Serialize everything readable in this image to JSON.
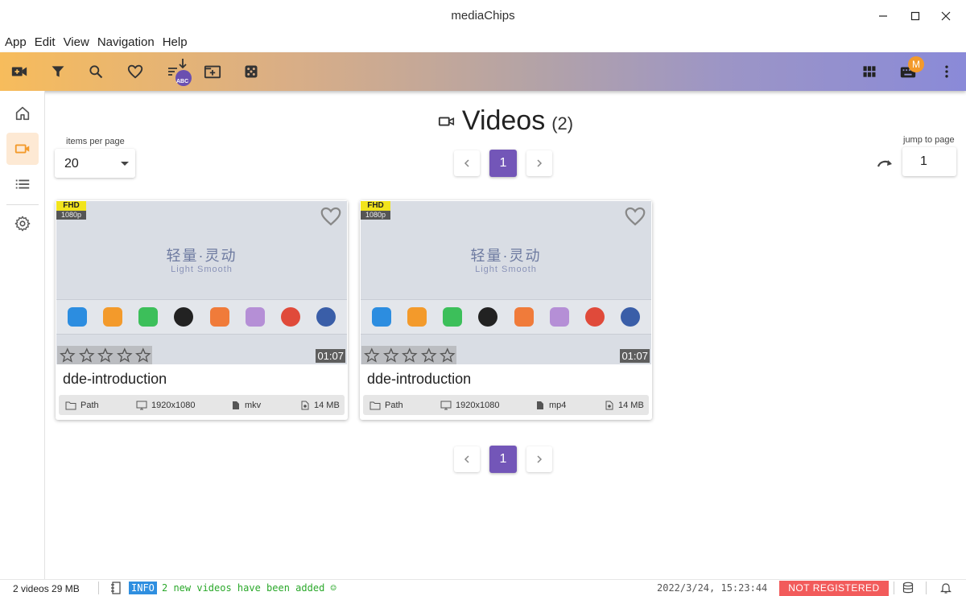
{
  "window": {
    "title": "mediaChips"
  },
  "menu": [
    "App",
    "Edit",
    "View",
    "Navigation",
    "Help"
  ],
  "toolbar": {
    "sort_badge": "ABC",
    "avatar_letter": "M",
    "icons": [
      "add-video-icon",
      "filter-icon",
      "search-icon",
      "heart-icon",
      "sort-icon",
      "add-tab-icon",
      "dice-icon",
      "grid-view-icon",
      "keyboard-icon",
      "more-vert-icon"
    ]
  },
  "sidebar": {
    "items": [
      "home-icon",
      "videos-icon",
      "list-icon",
      "settings-icon"
    ],
    "active": "videos-icon"
  },
  "page": {
    "title": "Videos",
    "count": "(2)",
    "items_per_page_label": "items per page",
    "items_per_page": "20",
    "current_page": "1",
    "jump_label": "jump to page",
    "jump_value": "1"
  },
  "cards": [
    {
      "title": "dde-introduction",
      "quality": "FHD",
      "resolution_tag": "1080p",
      "duration": "01:07",
      "thumb_text_zh": "轻量·灵动",
      "thumb_text_en": "Light Smooth",
      "path": "Path",
      "resolution": "1920x1080",
      "format": "mkv",
      "size": "14 MB",
      "rating": 0
    },
    {
      "title": "dde-introduction",
      "quality": "FHD",
      "resolution_tag": "1080p",
      "duration": "01:07",
      "thumb_text_zh": "轻量·灵动",
      "thumb_text_en": "Light Smooth",
      "path": "Path",
      "resolution": "1920x1080",
      "format": "mp4",
      "size": "14 MB",
      "rating": 0
    }
  ],
  "status": {
    "summary": "2 videos 29 MB",
    "level": "INFO",
    "message": "2 new videos have been added ☺",
    "timestamp": "2022/3/24, 15:23:44",
    "registration": "NOT REGISTERED"
  },
  "colors": {
    "accent": "#7356b8",
    "toolbar_start": "#f7bc5c",
    "toolbar_end": "#8a8ad8",
    "active_nav": "#f39a2b",
    "avatar": "#f39a2b",
    "not_registered": "#f25b5b",
    "info": "#2f8fe0"
  }
}
